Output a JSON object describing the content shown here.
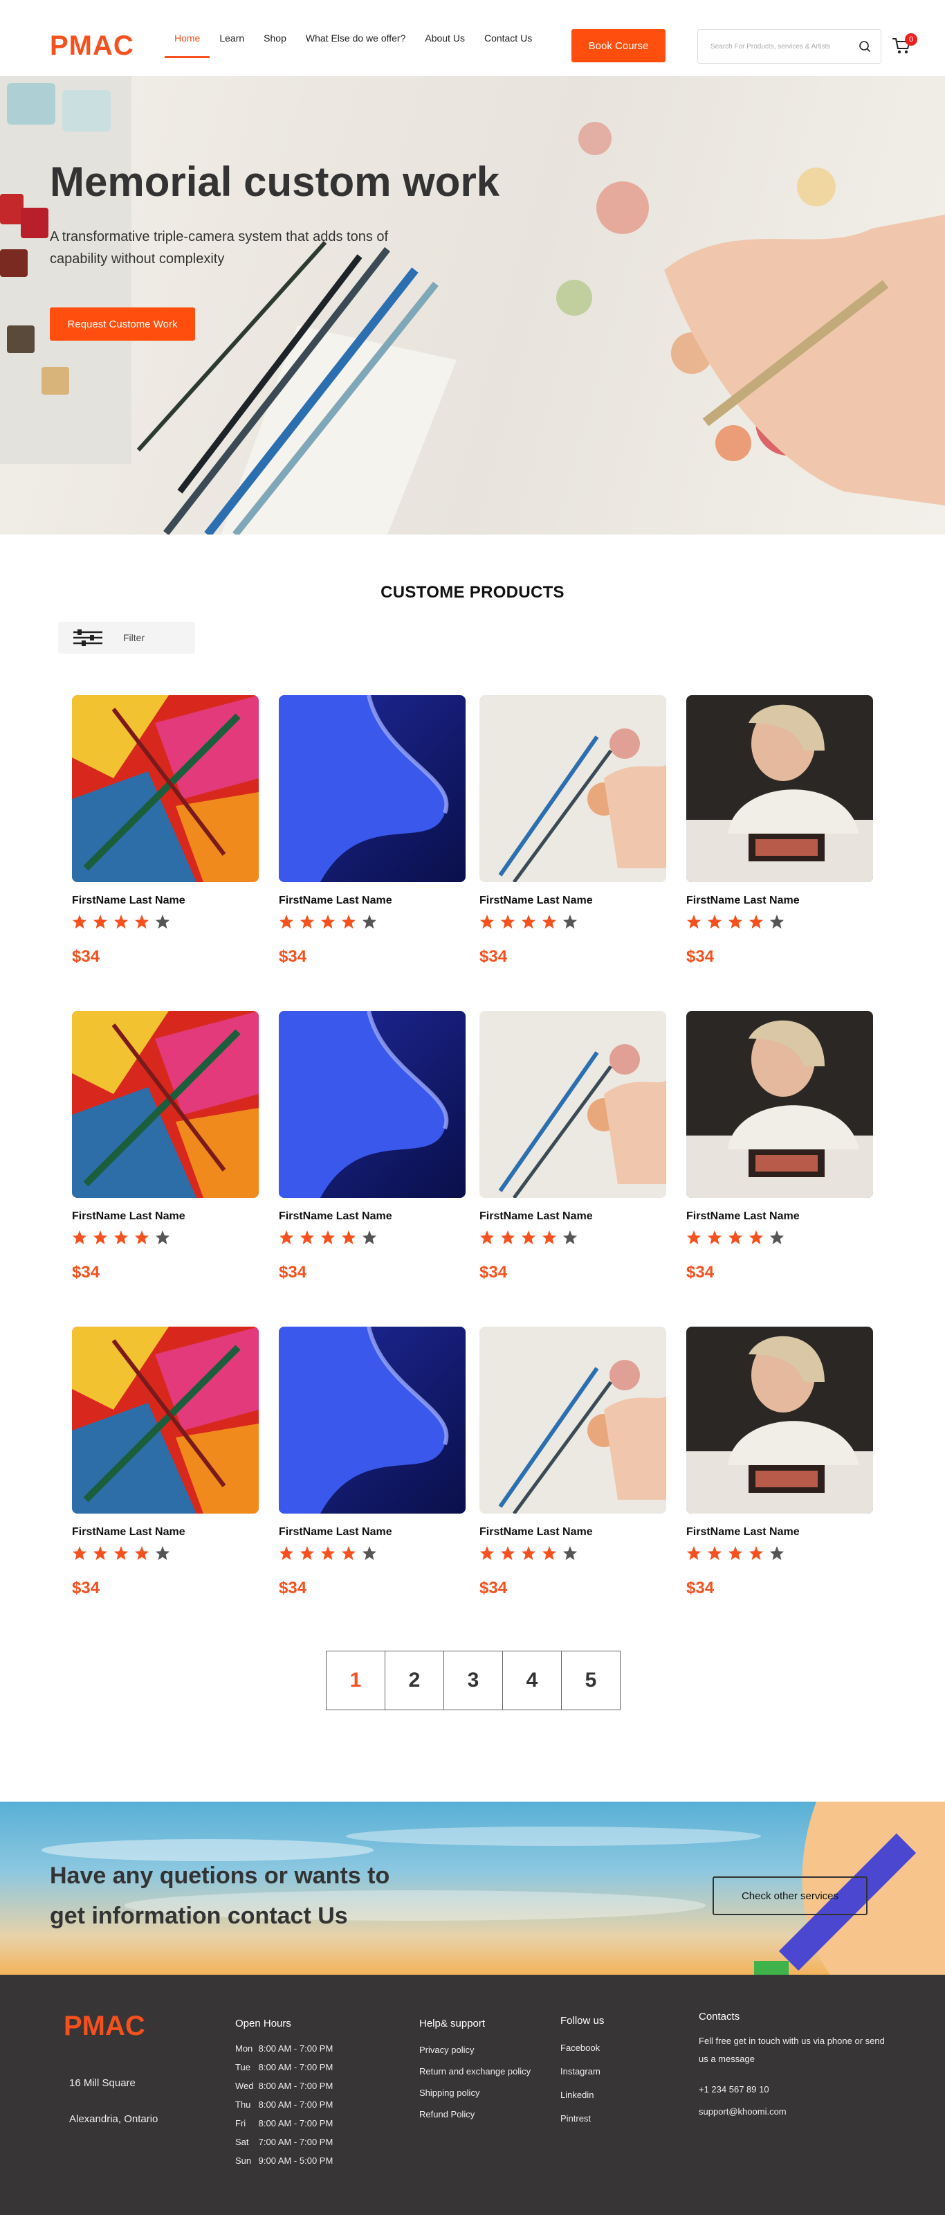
{
  "header": {
    "logo": "PMAC",
    "nav": [
      "Home",
      "Learn",
      "Shop",
      "What Else do we offer?",
      "About Us",
      "Contact Us"
    ],
    "book_label": "Book Course",
    "search_placeholder": "Search For Products, services & Artists",
    "cart_count": "0"
  },
  "hero": {
    "title": "Memorial custom work",
    "subtitle": "A transformative triple-camera system that adds tons of capability without complexity",
    "button": "Request Custome Work"
  },
  "products": {
    "title": "CUSTOME PRODUCTS",
    "filter_label": "Filter",
    "items": [
      {
        "name": "FirstName Last Name",
        "price": "$34",
        "rating": 4
      },
      {
        "name": "FirstName Last Name",
        "price": "$34",
        "rating": 4
      },
      {
        "name": "FirstName Last Name",
        "price": "$34",
        "rating": 4
      },
      {
        "name": "FirstName Last Name",
        "price": "$34",
        "rating": 4
      },
      {
        "name": "FirstName Last Name",
        "price": "$34",
        "rating": 4
      },
      {
        "name": "FirstName Last Name",
        "price": "$34",
        "rating": 4
      },
      {
        "name": "FirstName Last Name",
        "price": "$34",
        "rating": 4
      },
      {
        "name": "FirstName Last Name",
        "price": "$34",
        "rating": 4
      },
      {
        "name": "FirstName Last Name",
        "price": "$34",
        "rating": 4
      },
      {
        "name": "FirstName Last Name",
        "price": "$34",
        "rating": 4
      },
      {
        "name": "FirstName Last Name",
        "price": "$34",
        "rating": 4
      },
      {
        "name": "FirstName Last Name",
        "price": "$34",
        "rating": 4
      }
    ],
    "pages": [
      "1",
      "2",
      "3",
      "4",
      "5"
    ],
    "current_page": "1"
  },
  "cta": {
    "line1": "Have any quetions  or  wants to",
    "line2": "get information contact  Us",
    "button": "Check other services"
  },
  "footer": {
    "logo": "PMAC",
    "address_line1": "16 Mill Square",
    "address_line2": "Alexandria, Ontario",
    "hours_title": "Open Hours",
    "hours": [
      {
        "day": "Mon",
        "time": "8:00 AM - 7:00 PM"
      },
      {
        "day": "Tue",
        "time": "8:00 AM - 7:00 PM"
      },
      {
        "day": "Wed",
        "time": "8:00 AM - 7:00 PM"
      },
      {
        "day": "Thu",
        "time": "8:00 AM - 7:00 PM"
      },
      {
        "day": "Fri",
        "time": "8:00 AM - 7:00 PM"
      },
      {
        "day": "Sat",
        "time": "7:00 AM - 7:00 PM"
      },
      {
        "day": "Sun",
        "time": "9:00 AM - 5:00 PM"
      }
    ],
    "help_title": "Help& support",
    "help_links": [
      "Privacy policy",
      "Return and exchange policy",
      "Shipping policy",
      "Refund Policy"
    ],
    "follow_title": "Follow us",
    "follow_links": [
      "Facebook",
      "Instagram",
      "Linkedin",
      "Pintrest"
    ],
    "contacts_title": "Contacts",
    "contacts_text": "Fell free get in touch with us via phone or send us a message",
    "phone": "+1 234 567 89 10",
    "email": "support@khoomi.com"
  },
  "colors": {
    "accent": "#f4511e",
    "footer_bg": "#373535"
  }
}
